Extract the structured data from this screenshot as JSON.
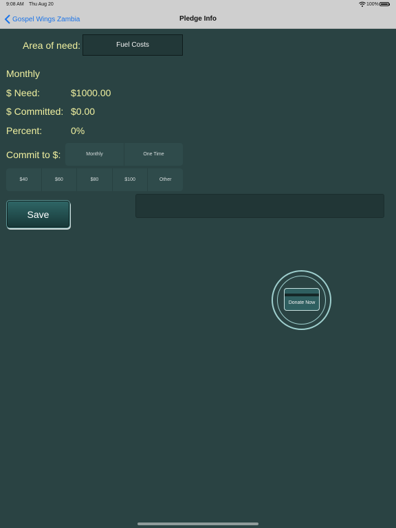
{
  "status_bar": {
    "time": "9:08 AM",
    "date": "Thu Aug 20",
    "battery": "100%",
    "icons": [
      "wifi-icon",
      "battery-icon"
    ]
  },
  "nav": {
    "back_label": "Gospel Wings Zambia",
    "title": "Pledge Info",
    "back_icon": "chevron-left-icon"
  },
  "form": {
    "area_label": "Area of need:",
    "area_value": "Fuel Costs",
    "frequency": "Monthly",
    "need_label": "$ Need:",
    "need_value": "$1000.00",
    "committed_label": "$ Committed:",
    "committed_value": "$0.00",
    "percent_label": "Percent:",
    "percent_value": "0%",
    "commit_label": "Commit to $:",
    "frequency_options": [
      "Monthly",
      "One Time"
    ],
    "amount_options": [
      "$40",
      "$60",
      "$80",
      "$100",
      "Other"
    ],
    "save_label": "Save"
  },
  "donate": {
    "label": "Donate Now",
    "icon": "credit-card-icon"
  },
  "colors": {
    "background": "#2a4343",
    "label_text": "#f0f0a0",
    "nav_link": "#1a73e8",
    "ring": "#9fd0cf"
  }
}
